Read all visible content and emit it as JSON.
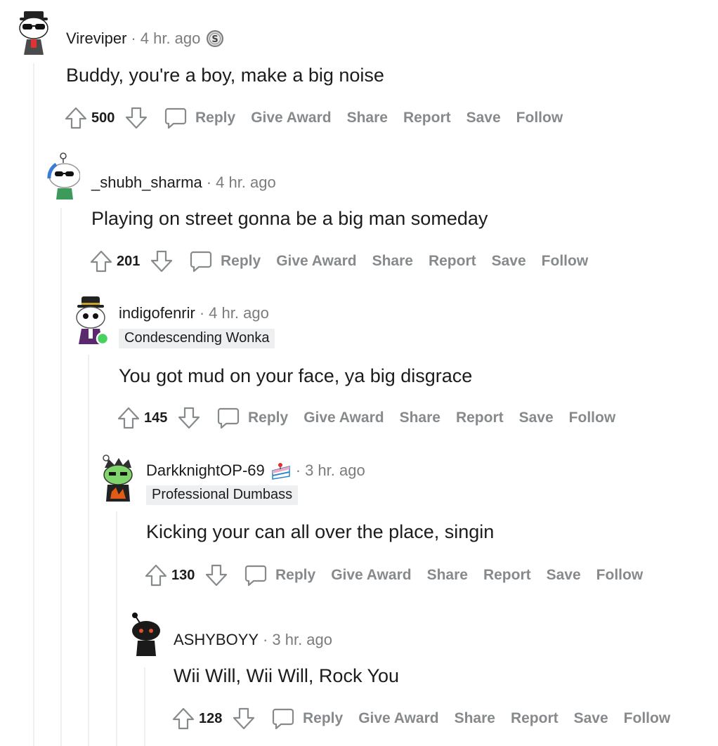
{
  "actions": {
    "reply": "Reply",
    "give_award": "Give Award",
    "share": "Share",
    "report": "Report",
    "save": "Save",
    "follow": "Follow"
  },
  "comments": [
    {
      "username": "Vireviper",
      "time": "4 hr. ago",
      "badge_icon": "silver-coin-icon",
      "flair": "",
      "body": "Buddy, you're a boy, make a big noise",
      "score": "500"
    },
    {
      "username": "_shubh_sharma",
      "time": "4 hr. ago",
      "flair": "",
      "body": "Playing on street gonna be a big man someday",
      "score": "201"
    },
    {
      "username": "indigofenrir",
      "time": "4 hr. ago",
      "online": true,
      "flair": "Condescending Wonka",
      "body": "You got mud on your face, ya big disgrace",
      "score": "145"
    },
    {
      "username": "DarkknightOP-69",
      "time": "3 hr. ago",
      "badge_icon": "cake-day-icon",
      "flair": "Professional Dumbass",
      "body": "Kicking your can all over the place, singin",
      "score": "130"
    },
    {
      "username": "ASHYBOYY",
      "time": "3 hr. ago",
      "flair": "",
      "body": "Wii Will, Wii Will, Rock You",
      "score": "128"
    }
  ],
  "colors": {
    "action_gray": "#878a8c",
    "thread_line": "#edeff1",
    "text": "#1c1c1c",
    "meta": "#7c7c7c",
    "online_green": "#46d160"
  }
}
